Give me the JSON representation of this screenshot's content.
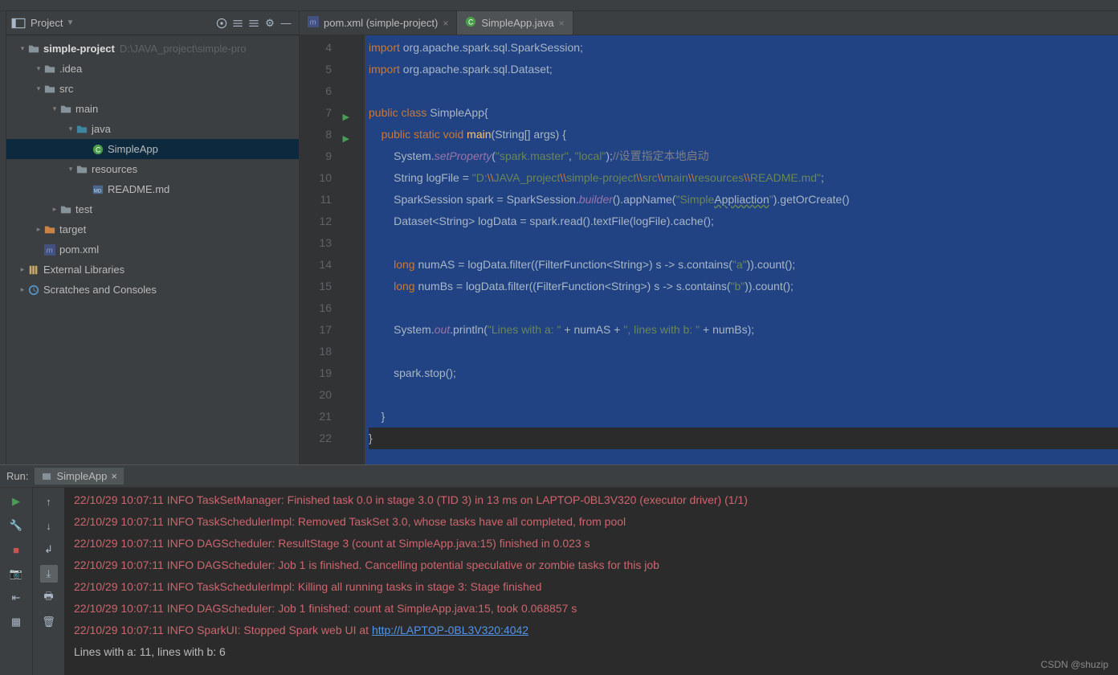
{
  "project": {
    "title": "Project",
    "root": "simple-project",
    "rootPath": "D:\\JAVA_project\\simple-pro",
    "tree": [
      {
        "ind": 1,
        "arrow": "▾",
        "icon": "folder",
        "label": ".idea"
      },
      {
        "ind": 1,
        "arrow": "▾",
        "icon": "folder",
        "label": "src"
      },
      {
        "ind": 2,
        "arrow": "▾",
        "icon": "folder",
        "label": "main"
      },
      {
        "ind": 3,
        "arrow": "▾",
        "icon": "src",
        "label": "java"
      },
      {
        "ind": 4,
        "arrow": "",
        "icon": "c",
        "label": "SimpleApp",
        "sel": true
      },
      {
        "ind": 3,
        "arrow": "▾",
        "icon": "folder",
        "label": "resources"
      },
      {
        "ind": 4,
        "arrow": "",
        "icon": "md",
        "label": "README.md"
      },
      {
        "ind": 2,
        "arrow": "▸",
        "icon": "folder",
        "label": "test"
      },
      {
        "ind": 1,
        "arrow": "▸",
        "icon": "folder-o",
        "label": "target"
      },
      {
        "ind": 1,
        "arrow": "",
        "icon": "m",
        "label": "pom.xml"
      }
    ],
    "external": "External Libraries",
    "scratches": "Scratches and Consoles"
  },
  "tabs": [
    {
      "icon": "m",
      "label": "pom.xml (simple-project)",
      "active": false
    },
    {
      "icon": "c",
      "label": "SimpleApp.java",
      "active": true
    }
  ],
  "code": {
    "startLine": 4,
    "runLines": [
      7,
      8
    ],
    "lines": [
      "<span class='kw'>import</span> <span class='id'>org.apache.spark.sql.SparkSession;</span>",
      "<span class='kw'>import</span> <span class='id'>org.apache.spark.sql.Dataset;</span>",
      "",
      "<span class='kw'>public class</span> <span class='id'>SimpleApp{</span>",
      "    <span class='kw'>public static void</span> <span class='fn'>main</span><span class='id'>(String[] args) {</span>",
      "        <span class='id'>System.</span><span class='fld'>setProperty</span><span class='id'>(</span><span class='str'>\"spark.master\"</span><span class='id'>, </span><span class='str'>\"local\"</span><span class='id'>);</span><span class='cmt'>//设置指定本地启动</span>",
      "        <span class='id'>String logFile = </span><span class='str'>\"D:<span class='esc'>\\\\</span>JAVA_project<span class='esc'>\\\\</span>simple-project<span class='esc'>\\\\</span>src<span class='esc'>\\\\</span>main<span class='esc'>\\\\</span>resources<span class='esc'>\\\\</span>README.md\"</span><span class='id'>;</span>",
      "        <span class='id'>SparkSession spark = SparkSession.</span><span class='fld'>builder</span><span class='id'>().appName(</span><span class='str'>\"Simple<span class='typo'>Appliaction</span>\"</span><span class='id'>).getOrCreate()</span>",
      "        <span class='id'>Dataset&lt;String&gt; logData = spark.read().textFile(logFile).cache();</span>",
      "",
      "        <span class='kw'>long</span> <span class='id'>numAS = logData.filter((FilterFunction&lt;String&gt;) s -&gt; s.contains(</span><span class='str'>\"a\"</span><span class='id'>)).count();</span>",
      "        <span class='kw'>long</span> <span class='id'>numBs = logData.filter((FilterFunction&lt;String&gt;) s -&gt; s.contains(</span><span class='str'>\"b\"</span><span class='id'>)).count();</span>",
      "",
      "        <span class='id'>System.</span><span class='fld'>out</span><span class='id'>.println(</span><span class='str'>\"Lines with a: \"</span><span class='id'> + numAS + </span><span class='str'>\", lines with b: \"</span><span class='id'> + numBs);</span>",
      "",
      "        <span class='id'>spark.stop();</span>",
      "",
      "    <span class='id'>}</span>",
      "<span class='id'>}</span>"
    ]
  },
  "run": {
    "label": "Run:",
    "tab": "SimpleApp",
    "lines": [
      {
        "cls": "log",
        "html": "22/10/29 10:07:11 INFO TaskSetManager: Finished task 0.0 in stage 3.0 (TID 3) in 13 ms on LAPTOP-0BL3V320 (executor driver) (1/1)"
      },
      {
        "cls": "log",
        "html": "22/10/29 10:07:11 INFO TaskSchedulerImpl: Removed TaskSet 3.0, whose tasks have all completed, from pool"
      },
      {
        "cls": "log",
        "html": "22/10/29 10:07:11 INFO DAGScheduler: ResultStage 3 (count at SimpleApp.java:15) finished in 0.023 s"
      },
      {
        "cls": "log",
        "html": "22/10/29 10:07:11 INFO DAGScheduler: Job 1 is finished. Cancelling potential speculative or zombie tasks for this job"
      },
      {
        "cls": "log",
        "html": "22/10/29 10:07:11 INFO TaskSchedulerImpl: Killing all running tasks in stage 3: Stage finished"
      },
      {
        "cls": "log",
        "html": "22/10/29 10:07:11 INFO DAGScheduler: Job 1 finished: count at SimpleApp.java:15, took 0.068857 s"
      },
      {
        "cls": "log",
        "html": "22/10/29 10:07:11 INFO SparkUI: Stopped Spark web UI at <a href='#'>http://LAPTOP-0BL3V320:4042</a>"
      },
      {
        "cls": "out",
        "html": "Lines with a: 11, lines with b: 6"
      }
    ]
  },
  "watermark": "CSDN @shuzip"
}
